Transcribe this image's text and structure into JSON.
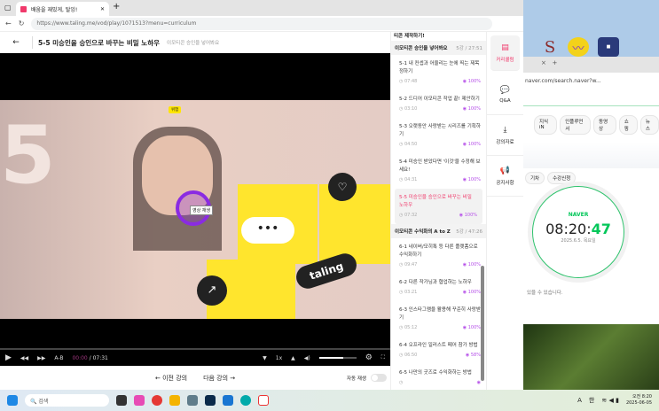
{
  "browser": {
    "tab_title": "배움을 재밌게, 탈잉!",
    "url": "https://www.taling.me/vod/play/1071513?menu=curriculum"
  },
  "header": {
    "lecture_title": "5-5 미승인을 승인으로 바꾸는 비밀 노하우",
    "section_subtitle": "이모티콘 승인을 넣어봐요"
  },
  "video": {
    "overlay_tag": "위험",
    "play_tooltip": "영상 재생",
    "brand_text": "taling",
    "big_number": "5"
  },
  "player": {
    "ab_label": "A-B",
    "current_time": "00:00",
    "duration": "07:31",
    "speed": "1x",
    "volume_fraction": 0.65,
    "progress_fraction": 0.0
  },
  "bottom_nav": {
    "prev": "← 이전 강의",
    "next": "다음 강의 →",
    "autoplay_label": "자동 재생",
    "autoplay_on": false
  },
  "curriculum": {
    "top_cut": "티콘 제작하기!",
    "sections": [
      {
        "title": "이모티콘 승인을 넣어봐요",
        "meta": "5강 / 27:51",
        "items": [
          {
            "title": "5-1 내 컨셉과 어울리는 눈에 띄는 제목 정하기",
            "time": "07:48",
            "progress": "100%"
          },
          {
            "title": "5-2 드디어 이모티콘 작업 끝! 제안하기",
            "time": "03:10",
            "progress": "100%"
          },
          {
            "title": "5-3 오랫동안 사랑받는 시리즈를 기획하기",
            "time": "04:50",
            "progress": "100%"
          },
          {
            "title": "5-4 미승인 받았다면 '이것'을 수정해 보세요!",
            "time": "04:31",
            "progress": "100%"
          },
          {
            "title": "5-5 미승인을 승인으로 바꾸는 비밀 노하우",
            "time": "07:32",
            "progress": "100%",
            "active": true
          }
        ]
      },
      {
        "title": "이모티콘 수익화의 A to Z",
        "meta": "5강 / 47:26",
        "items": [
          {
            "title": "6-1 네이버/모히톡 등 다른 플랫폼으로 수익화하기",
            "time": "09:47",
            "progress": "100%"
          },
          {
            "title": "6-2 다른 작가님과 협업하는 노하우",
            "time": "03:21",
            "progress": "100%"
          },
          {
            "title": "6-3 인스타그램을 활용해 꾸준히 사랑받기",
            "time": "05:12",
            "progress": "100%"
          },
          {
            "title": "6-4 오프라인 일러스트 페어 참가 방법",
            "time": "06:50",
            "progress": "58%"
          },
          {
            "title": "6-5 나만의 굿즈로 수익화하는 방법",
            "time": "",
            "progress": ""
          }
        ]
      }
    ]
  },
  "side_menu": [
    {
      "label": "커리큘럼",
      "icon": "curriculum-icon",
      "active": true
    },
    {
      "label": "Q&A",
      "icon": "chat-icon"
    },
    {
      "label": "강의자료",
      "icon": "download-icon"
    },
    {
      "label": "공지사항",
      "icon": "megaphone-icon"
    }
  ],
  "naver": {
    "url": "naver.com/search.naver?w...",
    "tabs": [
      "지식iN",
      "인플루언서",
      "동영상",
      "쇼핑",
      "뉴스"
    ],
    "chips": [
      "기차",
      "수강신청"
    ],
    "logo": "NAVER",
    "clock_hm": "08:20:",
    "clock_s": "47",
    "date": "2025.6.5. 목요일",
    "notice": "있을 수 있습니다."
  },
  "taskbar": {
    "search_placeholder": "검색",
    "time": "오전 8:20",
    "date": "2025-06-05",
    "ime": "한",
    "lang": "A"
  },
  "colors": {
    "accent": "#f0396b",
    "progress": "#b54fe8",
    "naver_green": "#03c75a"
  }
}
